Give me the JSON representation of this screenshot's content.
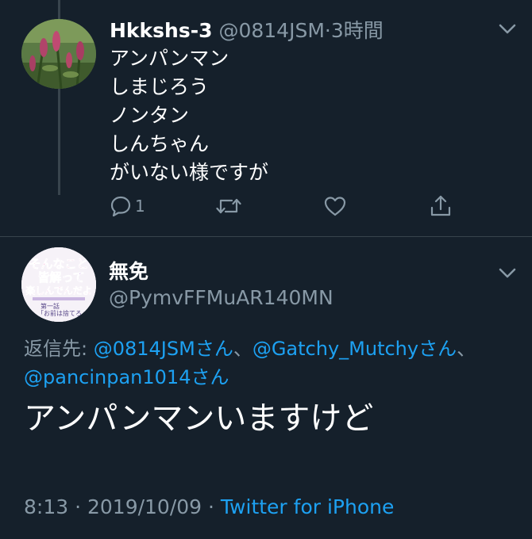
{
  "tweet1": {
    "display_name": "Hkkshs-3",
    "handle": "@0814JSM",
    "separator": "·",
    "time_ago": "3時間",
    "lines": [
      "アンパンマン",
      "しまじろう",
      "ノンタン",
      "しんちゃん",
      "がいない様ですが"
    ],
    "actions": {
      "reply_count": "1",
      "reply_icon": "reply-icon",
      "retweet_icon": "retweet-icon",
      "like_icon": "heart-icon",
      "share_icon": "share-icon"
    }
  },
  "tweet2": {
    "display_name": "無免",
    "handle": "@PymvFFMuAR140MN",
    "reply_to_label": "返信先: ",
    "reply_mentions": [
      "@0814JSMさん",
      "、",
      "@Gatchy_Mutchyさん",
      "、",
      "@pancinpan1014さん"
    ],
    "text": "アンパンマンいますけど",
    "time": "8:13",
    "meta_separator": " · ",
    "date": "2019/10/09",
    "source": "Twitter for iPhone",
    "avatar_text": [
      "そんなこと",
      "皆解って",
      "楽しんでんだよ",
      "第一話",
      "「お前は捨てろ」"
    ]
  },
  "colors": {
    "background": "#15202b",
    "text": "#ffffff",
    "muted": "#8899a6",
    "link": "#1da1f2",
    "divider": "#38444d"
  }
}
